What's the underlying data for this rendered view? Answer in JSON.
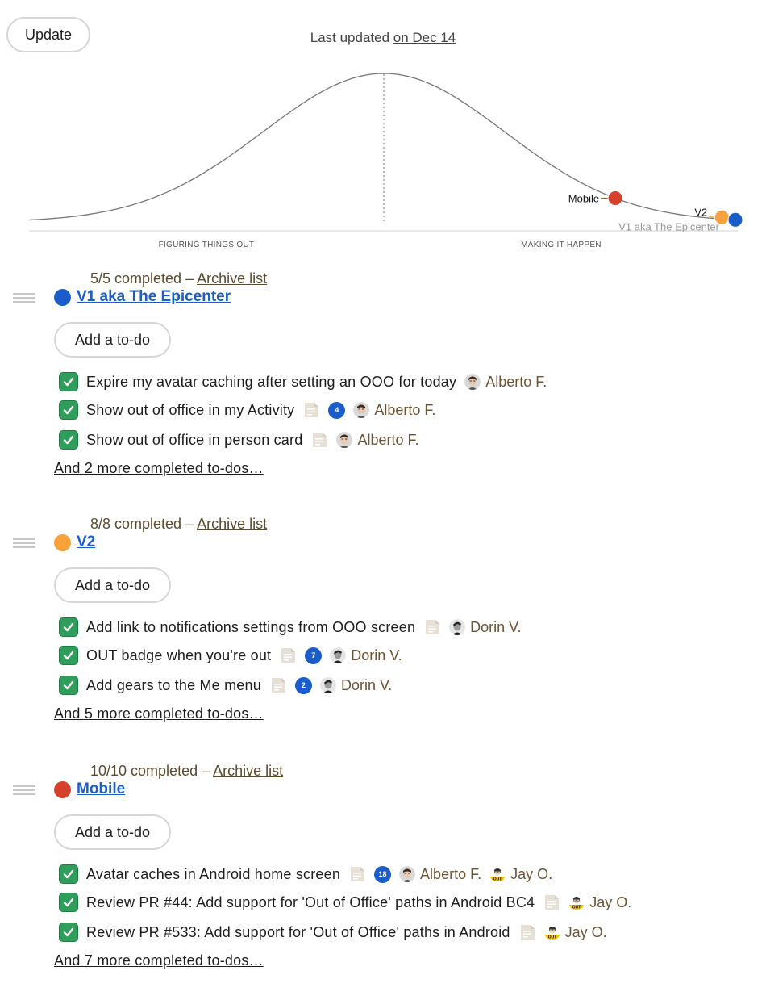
{
  "header": {
    "update_label": "Update",
    "last_updated_prefix": "Last updated ",
    "last_updated_link": "on Dec 14"
  },
  "hill_chart": {
    "left_label": "FIGURING THINGS OUT",
    "right_label": "MAKING IT HAPPEN",
    "points": [
      {
        "name": "Mobile",
        "position_pct": 83,
        "color": "#d6412b"
      },
      {
        "name": "V2",
        "position_pct": 99,
        "color": "#f9a23a"
      },
      {
        "name": "V1 aka The Epicenter",
        "position_pct": 100,
        "color": "#1a5cc8"
      }
    ]
  },
  "lists": [
    {
      "progress": "5/5 completed – ",
      "archive_label": "Archive list",
      "title": "V1 aka The Epicenter",
      "color": "#1a5cc8",
      "add_label": "Add a to-do",
      "todos": [
        {
          "text": "Expire my avatar caching after setting an OOO for today",
          "has_notes": false,
          "comments": null,
          "assignees": [
            {
              "name": "Alberto F.",
              "avatar": "alberto"
            }
          ]
        },
        {
          "text": "Show out of office in my Activity",
          "has_notes": true,
          "comments": "4",
          "assignees": [
            {
              "name": "Alberto F.",
              "avatar": "alberto"
            }
          ]
        },
        {
          "text": "Show out of office in person card",
          "has_notes": true,
          "comments": null,
          "assignees": [
            {
              "name": "Alberto F.",
              "avatar": "alberto"
            }
          ]
        }
      ],
      "more_label": "And 2 more completed to-dos…"
    },
    {
      "progress": "8/8 completed – ",
      "archive_label": "Archive list",
      "title": "V2",
      "color": "#f9a23a",
      "add_label": "Add a to-do",
      "todos": [
        {
          "text": "Add link to notifications settings from OOO screen",
          "has_notes": true,
          "comments": null,
          "assignees": [
            {
              "name": "Dorin V.",
              "avatar": "dorin"
            }
          ]
        },
        {
          "text": "OUT badge when you're out",
          "has_notes": true,
          "comments": "7",
          "assignees": [
            {
              "name": "Dorin V.",
              "avatar": "dorin"
            }
          ]
        },
        {
          "text": "Add gears to the Me menu",
          "has_notes": true,
          "comments": "2",
          "assignees": [
            {
              "name": "Dorin V.",
              "avatar": "dorin"
            }
          ]
        }
      ],
      "more_label": "And 5 more completed to-dos…"
    },
    {
      "progress": "10/10 completed – ",
      "archive_label": "Archive list",
      "title": "Mobile",
      "color": "#d6412b",
      "add_label": "Add a to-do",
      "todos": [
        {
          "text": "Avatar caches in Android home screen",
          "has_notes": true,
          "comments": "18",
          "assignees": [
            {
              "name": "Alberto F.",
              "avatar": "alberto"
            },
            {
              "name": "Jay O.",
              "avatar": "jay-out"
            }
          ]
        },
        {
          "text": "Review PR #44: Add support for 'Out of Office' paths in Android BC4",
          "has_notes": true,
          "comments": null,
          "assignees": [
            {
              "name": "Jay O.",
              "avatar": "jay-out"
            }
          ]
        },
        {
          "text": "Review PR #533: Add support for 'Out of Office' paths in Android",
          "has_notes": true,
          "comments": null,
          "assignees": [
            {
              "name": "Jay O.",
              "avatar": "jay-out"
            }
          ]
        }
      ],
      "more_label": "And 7 more completed to-dos…"
    }
  ]
}
